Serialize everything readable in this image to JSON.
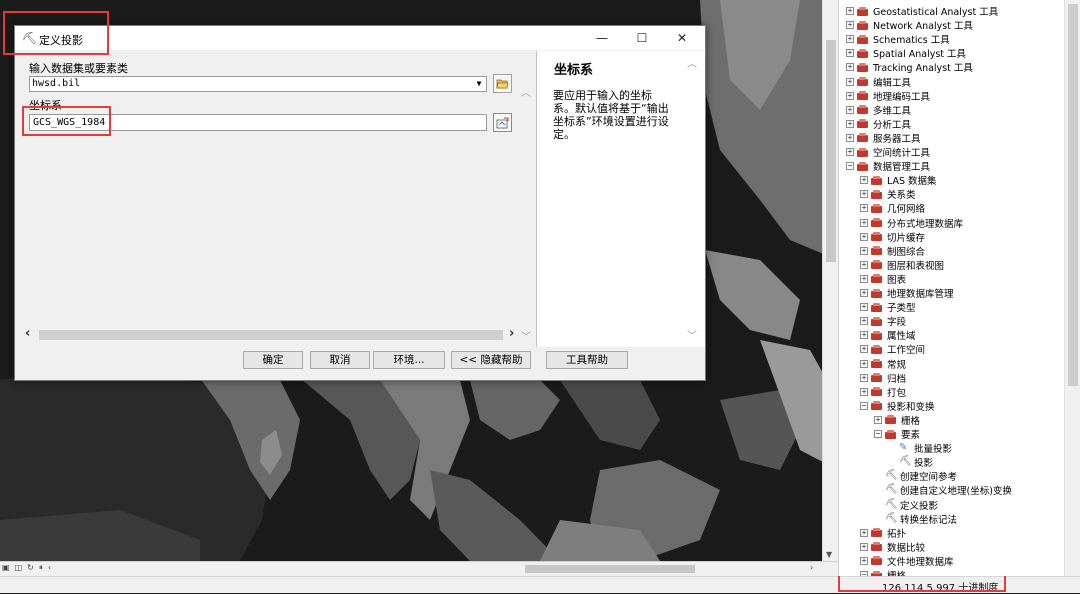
{
  "dialog": {
    "title": "定义投影",
    "input_label": "输入数据集或要素类",
    "input_value": "hwsd.bil",
    "cs_label": "坐标系",
    "cs_value": "GCS_WGS_1984",
    "buttons": {
      "ok": "确定",
      "cancel": "取消",
      "env": "环境...",
      "hide_help": "<< 隐藏帮助",
      "tool_help": "工具帮助"
    },
    "help": {
      "title": "坐标系",
      "body": "要应用于输入的坐标系。默认值将基于“输出坐标系”环境设置进行设定。"
    }
  },
  "toolbox": {
    "items": [
      {
        "label": "Geostatistical Analyst 工具",
        "level": 0,
        "exp": "+"
      },
      {
        "label": "Network Analyst 工具",
        "level": 0,
        "exp": "+"
      },
      {
        "label": "Schematics 工具",
        "level": 0,
        "exp": "+"
      },
      {
        "label": "Spatial Analyst 工具",
        "level": 0,
        "exp": "+"
      },
      {
        "label": "Tracking Analyst 工具",
        "level": 0,
        "exp": "+"
      },
      {
        "label": "编辑工具",
        "level": 0,
        "exp": "+"
      },
      {
        "label": "地理编码工具",
        "level": 0,
        "exp": "+"
      },
      {
        "label": "多维工具",
        "level": 0,
        "exp": "+"
      },
      {
        "label": "分析工具",
        "level": 0,
        "exp": "+"
      },
      {
        "label": "服务器工具",
        "level": 0,
        "exp": "+"
      },
      {
        "label": "空间统计工具",
        "level": 0,
        "exp": "+"
      },
      {
        "label": "数据管理工具",
        "level": 0,
        "exp": "-"
      },
      {
        "label": "LAS 数据集",
        "level": 1,
        "exp": "+"
      },
      {
        "label": "关系类",
        "level": 1,
        "exp": "+"
      },
      {
        "label": "几何网络",
        "level": 1,
        "exp": "+"
      },
      {
        "label": "分布式地理数据库",
        "level": 1,
        "exp": "+"
      },
      {
        "label": "切片缓存",
        "level": 1,
        "exp": "+"
      },
      {
        "label": "制图综合",
        "level": 1,
        "exp": "+"
      },
      {
        "label": "图层和表视图",
        "level": 1,
        "exp": "+"
      },
      {
        "label": "图表",
        "level": 1,
        "exp": "+"
      },
      {
        "label": "地理数据库管理",
        "level": 1,
        "exp": "+"
      },
      {
        "label": "子类型",
        "level": 1,
        "exp": "+"
      },
      {
        "label": "字段",
        "level": 1,
        "exp": "+"
      },
      {
        "label": "属性域",
        "level": 1,
        "exp": "+"
      },
      {
        "label": "工作空间",
        "level": 1,
        "exp": "+"
      },
      {
        "label": "常规",
        "level": 1,
        "exp": "+"
      },
      {
        "label": "归档",
        "level": 1,
        "exp": "+"
      },
      {
        "label": "打包",
        "level": 1,
        "exp": "+"
      },
      {
        "label": "投影和变换",
        "level": 1,
        "exp": "-"
      },
      {
        "label": "栅格",
        "level": 2,
        "exp": "+"
      },
      {
        "label": "要素",
        "level": 2,
        "exp": "-"
      },
      {
        "label": "批量投影",
        "level": 3,
        "exp": "",
        "icon": "script"
      },
      {
        "label": "投影",
        "level": 3,
        "exp": "",
        "icon": "hammer"
      },
      {
        "label": "创建空间参考",
        "level": 2,
        "exp": "",
        "icon": "hammer"
      },
      {
        "label": "创建自定义地理(坐标)变换",
        "level": 2,
        "exp": "",
        "icon": "hammer"
      },
      {
        "label": "定义投影",
        "level": 2,
        "exp": "",
        "icon": "hammer"
      },
      {
        "label": "转换坐标记法",
        "level": 2,
        "exp": "",
        "icon": "hammer"
      },
      {
        "label": "拓扑",
        "level": 1,
        "exp": "+"
      },
      {
        "label": "数据比较",
        "level": 1,
        "exp": "+"
      },
      {
        "label": "文件地理数据库",
        "level": 1,
        "exp": "+"
      },
      {
        "label": "栅格",
        "level": 1,
        "exp": "-"
      }
    ]
  },
  "status": {
    "coords": "126.114  5.997 十进制度"
  },
  "colors": {
    "highlight_red": "#e23b3b",
    "toolbox_red": "#c0392b"
  }
}
